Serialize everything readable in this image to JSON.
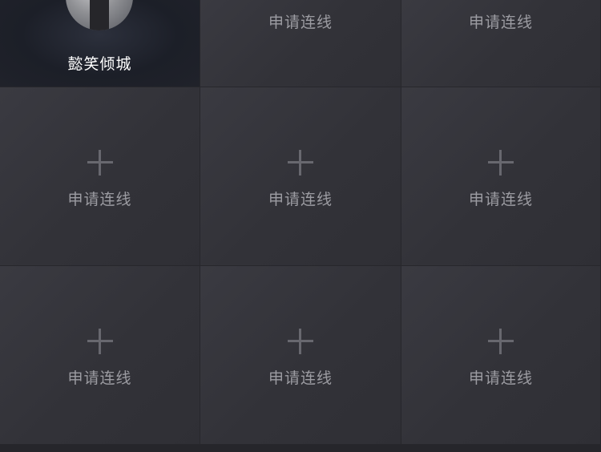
{
  "seats": {
    "host": {
      "nickname": "懿笑倾城"
    },
    "apply_label": "申请连线",
    "empty_seats": [
      {
        "label": "申请连线",
        "show_plus": false
      },
      {
        "label": "申请连线",
        "show_plus": false
      },
      {
        "label": "申请连线",
        "show_plus": true
      },
      {
        "label": "申请连线",
        "show_plus": true
      },
      {
        "label": "申请连线",
        "show_plus": true
      },
      {
        "label": "申请连线",
        "show_plus": true
      },
      {
        "label": "申请连线",
        "show_plus": true
      },
      {
        "label": "申请连线",
        "show_plus": true
      }
    ]
  },
  "icons": {
    "add": "plus-icon",
    "avatar": "avatar"
  },
  "colors": {
    "cell_bg": "#35353b",
    "label_text": "#9c9ca2",
    "plus": "#68686f",
    "nickname_text": "#ffffff"
  }
}
